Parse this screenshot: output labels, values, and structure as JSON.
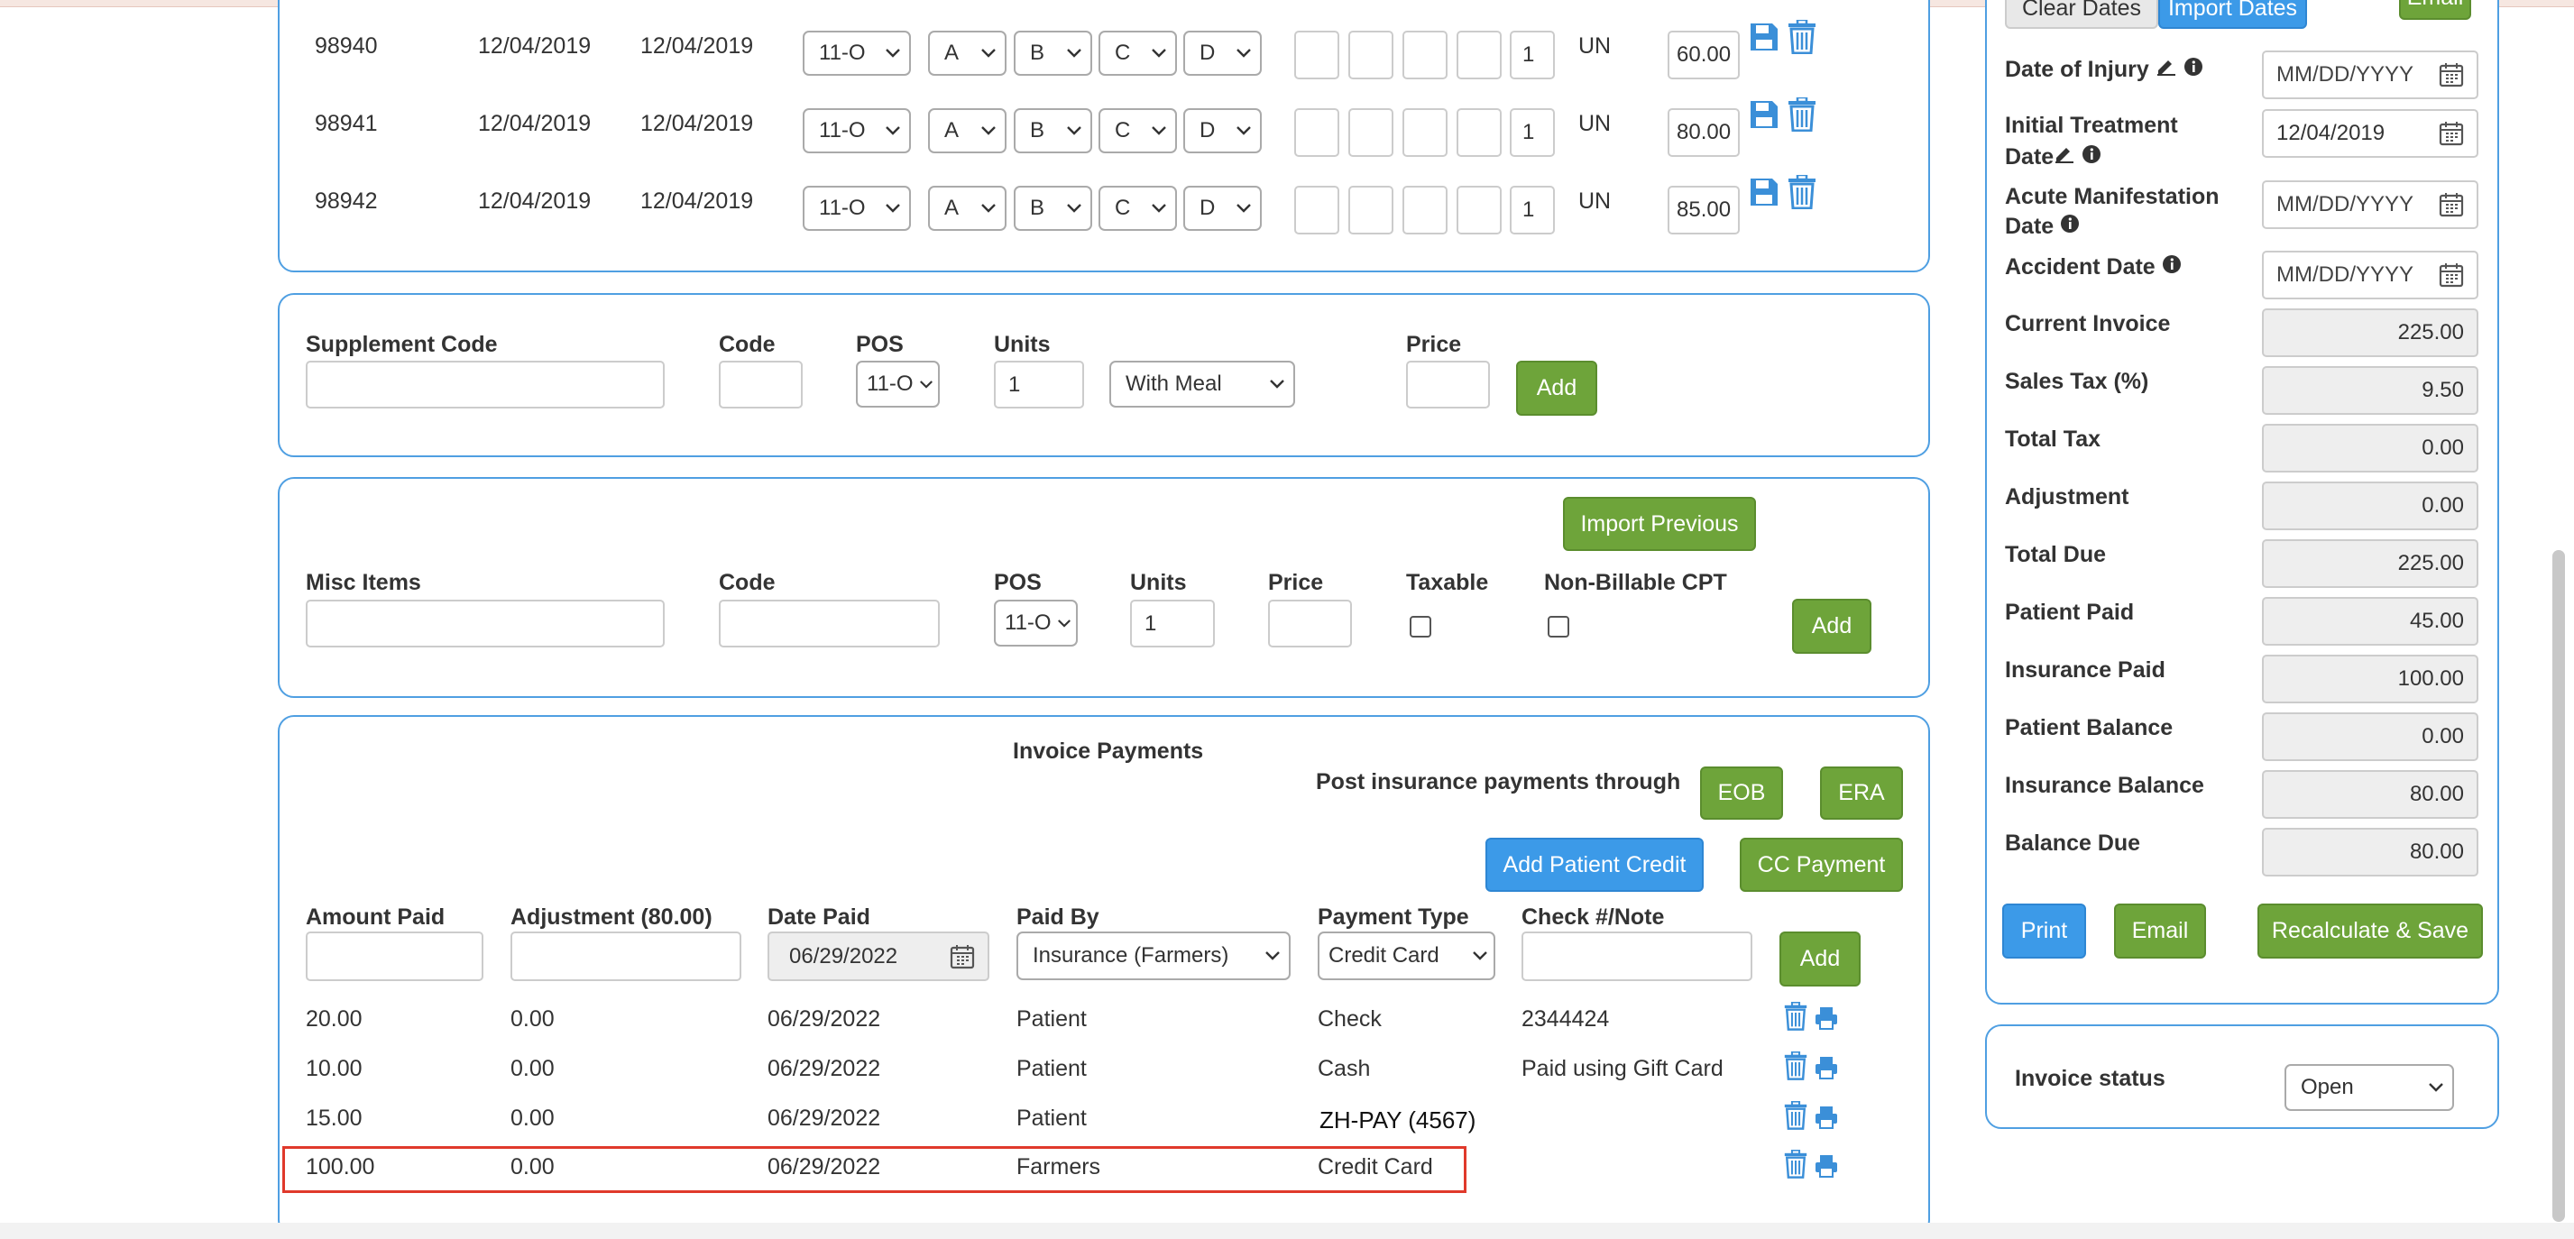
{
  "service_rows": [
    {
      "code": "98940",
      "from": "12/04/2019",
      "to": "12/04/2019",
      "pos": "11-O",
      "d1": "A",
      "d2": "B",
      "d3": "C",
      "d4": "D",
      "units": "1",
      "un": "UN",
      "price": "60.00"
    },
    {
      "code": "98941",
      "from": "12/04/2019",
      "to": "12/04/2019",
      "pos": "11-O",
      "d1": "A",
      "d2": "B",
      "d3": "C",
      "d4": "D",
      "units": "1",
      "un": "UN",
      "price": "80.00"
    },
    {
      "code": "98942",
      "from": "12/04/2019",
      "to": "12/04/2019",
      "pos": "11-O",
      "d1": "A",
      "d2": "B",
      "d3": "C",
      "d4": "D",
      "units": "1",
      "un": "UN",
      "price": "85.00"
    }
  ],
  "supplement": {
    "label": "Supplement Code",
    "code_label": "Code",
    "pos_label": "POS",
    "units_label": "Units",
    "price_label": "Price",
    "pos": "11-O",
    "units": "1",
    "meal": "With Meal",
    "add": "Add"
  },
  "misc": {
    "label": "Misc Items",
    "code_label": "Code",
    "pos_label": "POS",
    "units_label": "Units",
    "price_label": "Price",
    "taxable_label": "Taxable",
    "nonbillable_label": "Non-Billable CPT",
    "pos": "11-O",
    "units": "1",
    "import_previous": "Import Previous",
    "add": "Add"
  },
  "payments": {
    "title": "Invoice Payments",
    "post_through": "Post insurance payments through",
    "eob": "EOB",
    "era": "ERA",
    "add_patient_credit": "Add Patient Credit",
    "cc_payment": "CC Payment",
    "headers": {
      "amount": "Amount Paid",
      "adjustment": "Adjustment (80.00)",
      "date": "Date Paid",
      "paid_by": "Paid By",
      "type": "Payment Type",
      "note": "Check #/Note"
    },
    "date_value": "06/29/2022",
    "paid_by_value": "Insurance (Farmers)",
    "type_value": "Credit Card",
    "add": "Add",
    "rows": [
      {
        "amount": "20.00",
        "adjustment": "0.00",
        "date": "06/29/2022",
        "by": "Patient",
        "type": "Check",
        "note": "2344424"
      },
      {
        "amount": "10.00",
        "adjustment": "0.00",
        "date": "06/29/2022",
        "by": "Patient",
        "type": "Cash",
        "note": "Paid using Gift Card"
      },
      {
        "amount": "15.00",
        "adjustment": "0.00",
        "date": "06/29/2022",
        "by": "Patient",
        "type": "ZH-PAY (4567)",
        "note": ""
      },
      {
        "amount": "100.00",
        "adjustment": "0.00",
        "date": "06/29/2022",
        "by": "Farmers",
        "type": "Credit Card",
        "note": ""
      }
    ]
  },
  "side": {
    "clear_dates": "Clear Dates",
    "import_dates": "Import Dates",
    "email_top": "Email",
    "date_placeholder": "MM/DD/YYYY",
    "date_of_injury": "Date of Injury",
    "initial_treatment_1": "Initial Treatment",
    "initial_treatment_2": "Date",
    "initial_treatment_value": "12/04/2019",
    "acute_1": "Acute Manifestation",
    "acute_2": "Date",
    "accident": "Accident Date",
    "fields": [
      {
        "label": "Current Invoice",
        "value": "225.00"
      },
      {
        "label": "Sales Tax (%)",
        "value": "9.50"
      },
      {
        "label": "Total Tax",
        "value": "0.00"
      },
      {
        "label": "Adjustment",
        "value": "0.00"
      },
      {
        "label": "Total Due",
        "value": "225.00"
      },
      {
        "label": "Patient Paid",
        "value": "45.00"
      },
      {
        "label": "Insurance Paid",
        "value": "100.00"
      },
      {
        "label": "Patient Balance",
        "value": "0.00"
      },
      {
        "label": "Insurance Balance",
        "value": "80.00"
      },
      {
        "label": "Balance Due",
        "value": "80.00"
      }
    ],
    "print": "Print",
    "email": "Email",
    "recalc": "Recalculate & Save",
    "status_label": "Invoice status",
    "status_value": "Open"
  }
}
